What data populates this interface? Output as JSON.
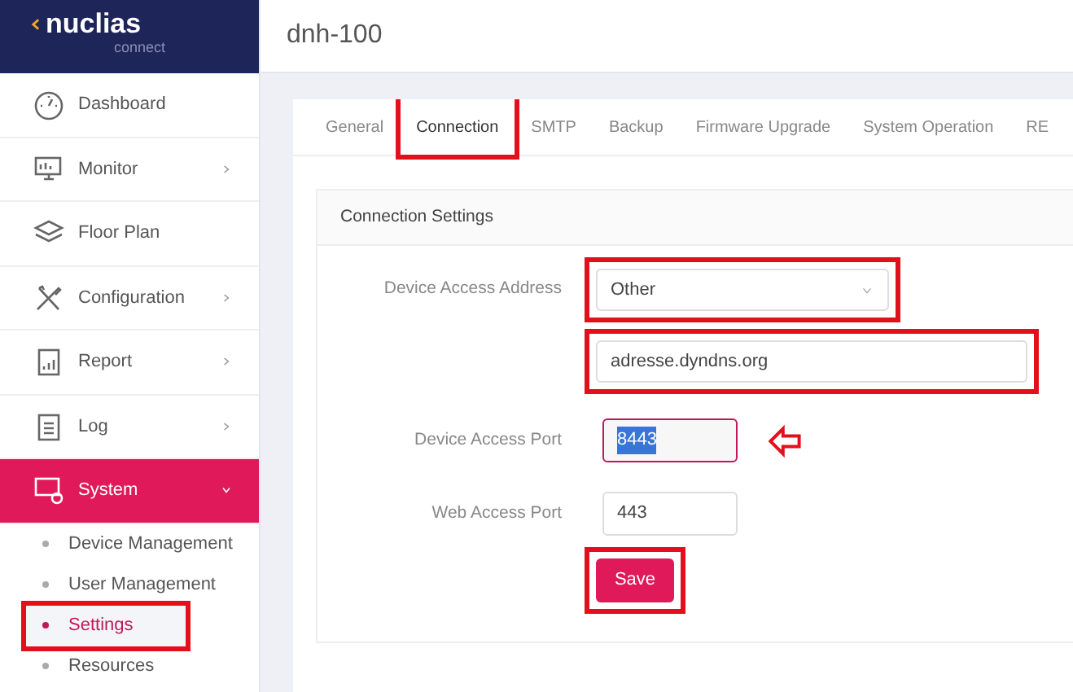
{
  "logo": {
    "name": "nuclias",
    "subtitle": "connect"
  },
  "sidebar": {
    "items": [
      {
        "label": "Dashboard",
        "has_submenu": false,
        "selected": false
      },
      {
        "label": "Monitor",
        "has_submenu": true,
        "selected": false
      },
      {
        "label": "Floor Plan",
        "has_submenu": false,
        "selected": false
      },
      {
        "label": "Configuration",
        "has_submenu": true,
        "selected": false
      },
      {
        "label": "Report",
        "has_submenu": true,
        "selected": false
      },
      {
        "label": "Log",
        "has_submenu": true,
        "selected": false
      },
      {
        "label": "System",
        "has_submenu": true,
        "selected": true,
        "expanded": true,
        "children": [
          {
            "label": "Device Management",
            "selected": false,
            "highlighted": false
          },
          {
            "label": "User Management",
            "selected": false,
            "highlighted": false
          },
          {
            "label": "Settings",
            "selected": true,
            "highlighted": true
          },
          {
            "label": "Resources",
            "selected": false,
            "highlighted": false
          }
        ]
      }
    ]
  },
  "page_title": "dnh-100",
  "tabs": [
    {
      "label": "General",
      "selected": false,
      "highlighted": false
    },
    {
      "label": "Connection",
      "selected": true,
      "highlighted": true
    },
    {
      "label": "SMTP",
      "selected": false,
      "highlighted": false
    },
    {
      "label": "Backup",
      "selected": false,
      "highlighted": false
    },
    {
      "label": "Firmware Upgrade",
      "selected": false,
      "highlighted": false
    },
    {
      "label": "System Operation",
      "selected": false,
      "highlighted": false
    },
    {
      "label": "RE",
      "selected": false,
      "highlighted": false
    }
  ],
  "section_title": "Connection Settings",
  "form": [
    {
      "kind": "select",
      "label": "Device Access Address",
      "value": "Other",
      "highlighted": true,
      "arrow": false
    },
    {
      "kind": "text",
      "value": "adresse.dyndns.org",
      "highlighted": true,
      "arrow": false
    },
    {
      "kind": "port",
      "label": "Device Access Port",
      "value": "8443",
      "highlighted": false,
      "arrow": true,
      "text_selected": true
    },
    {
      "kind": "port",
      "label": "Web Access Port",
      "value": "443",
      "highlighted": false,
      "arrow": false,
      "text_selected": false
    }
  ],
  "save_button": {
    "label": "Save",
    "highlighted": true
  }
}
